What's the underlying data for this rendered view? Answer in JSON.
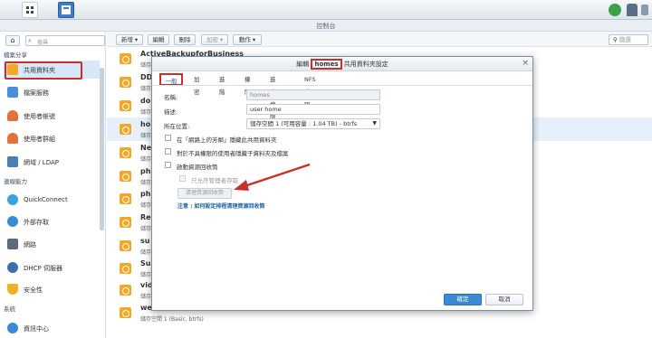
{
  "window": {
    "title": "控制台"
  },
  "sidebar": {
    "search_placeholder": "搜尋",
    "sections": [
      {
        "label": "檔案分享"
      },
      {
        "label": "連線能力"
      },
      {
        "label": "系統"
      }
    ],
    "items": [
      {
        "label": "共用資料夾",
        "icon": "shared-folder-icon",
        "color": "#f5a623"
      },
      {
        "label": "檔案服務",
        "icon": "file-services-icon",
        "color": "#4a90d9"
      },
      {
        "label": "使用者帳號",
        "icon": "user-icon",
        "color": "#e2713b"
      },
      {
        "label": "使用者群組",
        "icon": "group-icon",
        "color": "#e2713b"
      },
      {
        "label": "網域 / LDAP",
        "icon": "ldap-icon",
        "color": "#4a7fb5"
      },
      {
        "label": "QuickConnect",
        "icon": "quickconnect-icon",
        "color": "#3aa2e0"
      },
      {
        "label": "外部存取",
        "icon": "globe-icon",
        "color": "#3a8ad8"
      },
      {
        "label": "網路",
        "icon": "network-icon",
        "color": "#5b6b7c"
      },
      {
        "label": "DHCP 伺服器",
        "icon": "dhcp-icon",
        "color": "#3a6fb0"
      },
      {
        "label": "安全性",
        "icon": "shield-icon",
        "color": "#e8b325"
      },
      {
        "label": "資訊中心",
        "icon": "info-icon",
        "color": "#3a8ad8"
      }
    ]
  },
  "toolbar": {
    "create": "新增 ▾",
    "edit": "編輯",
    "delete": "刪除",
    "encrypt": "加密 ▾",
    "action": "動作 ▾",
    "filter_placeholder": "篩選"
  },
  "folders": [
    {
      "name": "ActiveBackupforBusiness",
      "sub": "儲存空間 1"
    },
    {
      "name": "DD",
      "sub": "儲存空間 1"
    },
    {
      "name": "do",
      "sub": "儲存空間 1"
    },
    {
      "name": "ho",
      "sub": "儲存空間 1"
    },
    {
      "name": "Ne",
      "sub": "儲存空間 1"
    },
    {
      "name": "ph",
      "sub": "儲存空間 1"
    },
    {
      "name": "ph",
      "sub": "儲存空間 1"
    },
    {
      "name": "Re",
      "sub": "儲存空間 1"
    },
    {
      "name": "su",
      "sub": "儲存空間 1"
    },
    {
      "name": "Su",
      "sub": "儲存空間 1"
    },
    {
      "name": "vid",
      "sub": "儲存空間 1"
    },
    {
      "name": "we",
      "sub": "儲存空間 1 (Basic, btrfs)"
    }
  ],
  "dialog": {
    "title_pre": "編輯",
    "title_name": "homes",
    "title_post": "共用資料夾設定",
    "tabs": [
      "一般",
      "加密",
      "進階",
      "權限",
      "進階權限",
      "NFS 權限"
    ],
    "name_label": "名稱:",
    "name_value": "homes",
    "desc_label": "描述:",
    "desc_value": "user home",
    "loc_label": "所在位置:",
    "loc_value": "儲存空間 1 (可用容量 : 1.04 TB) - btrfs",
    "cb1": "在「網路上的芳鄰」隱藏此共用資料夾",
    "cb2": "對於不具權限的使用者隱藏子資料夾及檔案",
    "cb3": "啟動資源回收筒",
    "cb4": "只允許管理者存取",
    "empty_btn": "清理資源回收筒",
    "note_pre": "注意 :",
    "note_link": "如何設定排程清理資源回收筒",
    "ok": "確定",
    "cancel": "取消"
  }
}
